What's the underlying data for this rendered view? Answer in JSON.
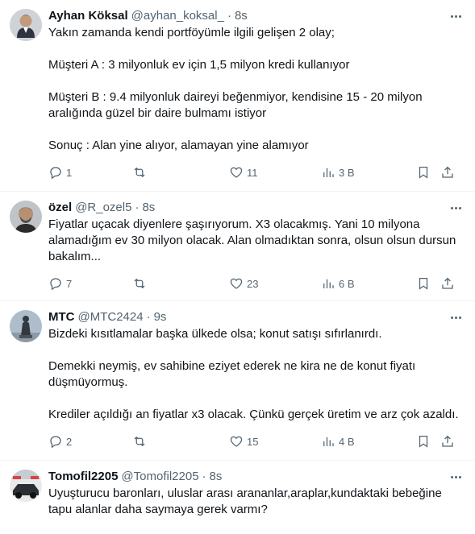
{
  "tweets": [
    {
      "name": "Ayhan Köksal",
      "handle": "@ayhan_koksal_",
      "separator": "·",
      "time": "8s",
      "text": "Yakın zamanda kendi portföyümle ilgili gelişen 2 olay;\n\nMüşteri A : 3 milyonluk ev için 1,5 milyon kredi kullanıyor\n\nMüşteri B : 9.4 milyonluk daireyi beğenmiyor, kendisine 15 - 20 milyon aralığında güzel bir daire bulmamı istiyor\n\nSonuç : Alan yine alıyor, alamayan yine alamıyor",
      "replies": "1",
      "retweets": "",
      "likes": "11",
      "views": "3 B"
    },
    {
      "name": "özel",
      "handle": "@R_ozel5",
      "separator": "·",
      "time": "8s",
      "text": "Fiyatlar uçacak diyenlere şaşırıyorum. X3 olacakmış. Yani 10 milyona alamadığım ev 30 milyon olacak. Alan olmadıktan sonra, olsun olsun dursun bakalım...",
      "replies": "7",
      "retweets": "",
      "likes": "23",
      "views": "6 B"
    },
    {
      "name": "MTC",
      "handle": "@MTC2424",
      "separator": "·",
      "time": "9s",
      "text": "Bizdeki kısıtlamalar başka ülkede olsa; konut satışı sıfırlanırdı.\n\nDemekki neymiş, ev sahibine eziyet ederek ne kira ne de konut fiyatı düşmüyormuş.\n\nKrediler açıldığı an fiyatlar x3 olacak. Çünkü gerçek üretim ve arz çok azaldı.",
      "replies": "2",
      "retweets": "",
      "likes": "15",
      "views": "4 B"
    },
    {
      "name": "Tomofil2205",
      "handle": "@Tomofil2205",
      "separator": "·",
      "time": "8s",
      "text": "Uyuşturucu baronları, uluslar arası arananlar,araplar,kundaktaki bebeğine tapu alanlar daha saymaya gerek varmı?"
    }
  ],
  "icons": {
    "reply": "reply-icon",
    "retweet": "retweet-icon",
    "like": "heart-icon",
    "views": "views-icon",
    "bookmark": "bookmark-icon",
    "share": "share-icon",
    "more": "more-icon"
  },
  "colors": {
    "text": "#0f1419",
    "secondary": "#536471",
    "divider": "#eff3f4"
  }
}
